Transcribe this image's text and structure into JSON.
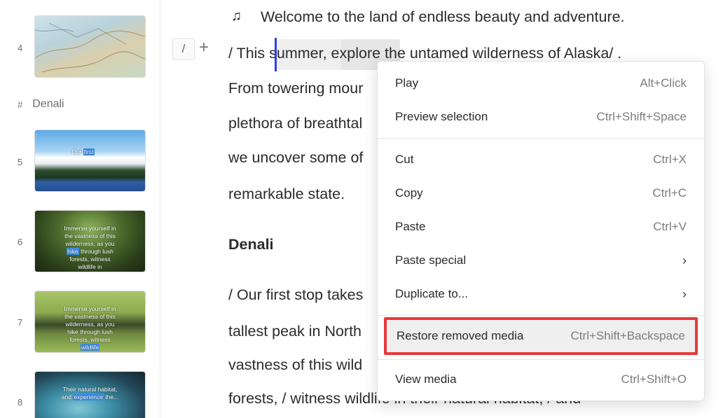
{
  "sidebar": {
    "scenes": [
      {
        "num": "4",
        "caption": ""
      },
      {
        "num": "5",
        "caption_pre": "Our ",
        "caption_hl": "first",
        "caption_post": ""
      },
      {
        "num": "6",
        "caption_pre": "Immerse yourself in the vastness of this wilderness, as you ",
        "caption_hl": "hike",
        "caption_post": " through lush forests, witness wildlife in"
      },
      {
        "num": "7",
        "caption_pre": "Immerse yourself in the vastness of this wilderness, as you hike through lush forests, witness ",
        "caption_hl": "wildlife",
        "caption_post": ""
      },
      {
        "num": "8",
        "caption_pre": "Their natural habitat, and ",
        "caption_hl": "experience",
        "caption_post": " the..."
      }
    ],
    "section_hash": "#",
    "section_title": "Denali"
  },
  "editor": {
    "line1": "Welcome to the land of endless beauty and adventure.",
    "line2": "/ This summer, explore the untamed wilderness of Alaska/ .",
    "line3": "From towering mour",
    "line4": "plethora of breathtal",
    "line5": "we uncover some of",
    "line6": "remarkable state.",
    "heading": "Denali",
    "line7": "/ Our first stop takes",
    "line8": "tallest peak in North",
    "line9": "vastness of this wild",
    "line10": "forests, / witness wildlife in their natural habitat, / and",
    "slash_label": "/",
    "plus_label": "+",
    "music_icon": "♫"
  },
  "context_menu": {
    "items": [
      {
        "label": "Play",
        "shortcut": "Alt+Click"
      },
      {
        "label": "Preview selection",
        "shortcut": "Ctrl+Shift+Space"
      },
      {
        "label": "Cut",
        "shortcut": "Ctrl+X"
      },
      {
        "label": "Copy",
        "shortcut": "Ctrl+C"
      },
      {
        "label": "Paste",
        "shortcut": "Ctrl+V"
      },
      {
        "label": "Paste special",
        "shortcut": "›"
      },
      {
        "label": "Duplicate to...",
        "shortcut": "›"
      },
      {
        "label": "Restore removed media",
        "shortcut": "Ctrl+Shift+Backspace"
      },
      {
        "label": "View media",
        "shortcut": "Ctrl+Shift+O"
      }
    ]
  },
  "colors": {
    "highlight_border": "#e8393a",
    "cursor": "#2f3fe0",
    "thumb_highlight": "#3b8ee8"
  }
}
